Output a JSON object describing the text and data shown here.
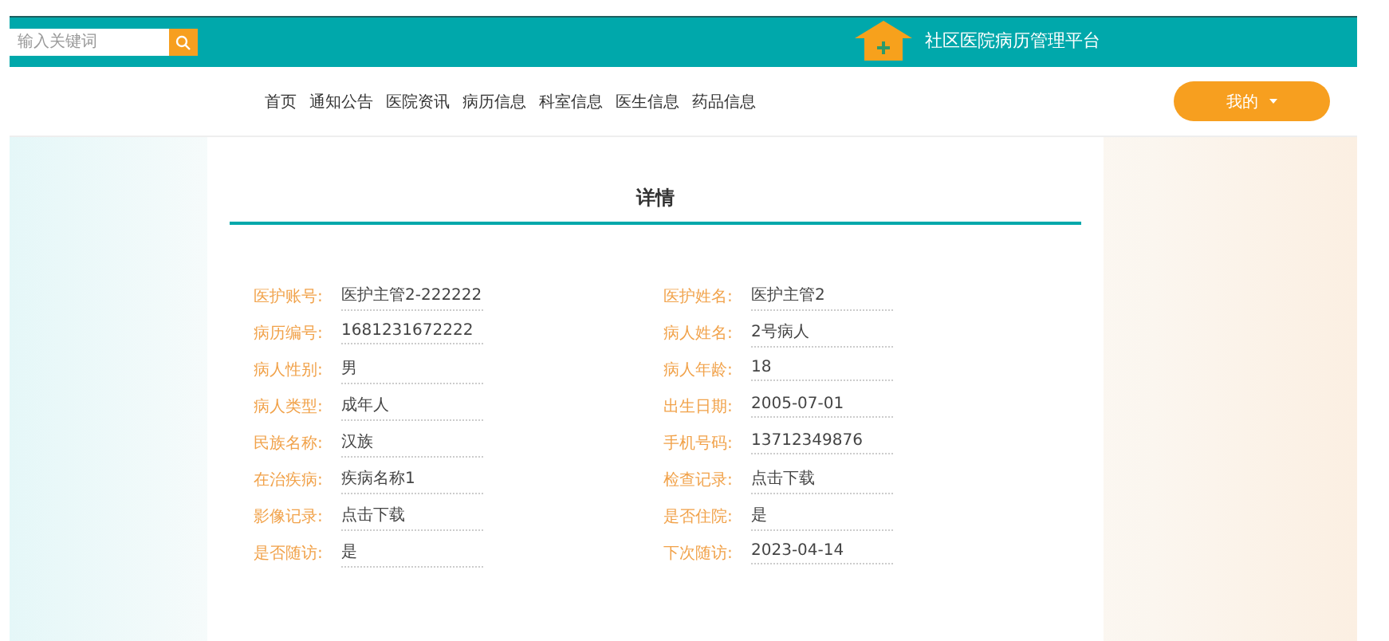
{
  "header": {
    "search": {
      "placeholder": "输入关键词"
    },
    "site_title": "社区医院病历管理平台"
  },
  "nav": {
    "items": [
      "首页",
      "通知公告",
      "医院资讯",
      "病历信息",
      "科室信息",
      "医生信息",
      "药品信息"
    ],
    "user_menu": "我的"
  },
  "detail": {
    "title": "详情",
    "fields": [
      {
        "label": "医护账号:",
        "value": "医护主管2-222222"
      },
      {
        "label": "医护姓名:",
        "value": "医护主管2"
      },
      {
        "label": "病历编号:",
        "value": "1681231672222"
      },
      {
        "label": "病人姓名:",
        "value": "2号病人"
      },
      {
        "label": "病人性别:",
        "value": "男"
      },
      {
        "label": "病人年龄:",
        "value": "18"
      },
      {
        "label": "病人类型:",
        "value": "成年人"
      },
      {
        "label": "出生日期:",
        "value": "2005-07-01"
      },
      {
        "label": "民族名称:",
        "value": "汉族"
      },
      {
        "label": "手机号码:",
        "value": "13712349876"
      },
      {
        "label": "在治疾病:",
        "value": "疾病名称1"
      },
      {
        "label": "检查记录:",
        "value": "点击下载"
      },
      {
        "label": "影像记录:",
        "value": "点击下载"
      },
      {
        "label": "是否住院:",
        "value": "是"
      },
      {
        "label": "是否随访:",
        "value": "是"
      },
      {
        "label": "下次随访:",
        "value": "2023-04-14"
      }
    ]
  }
}
